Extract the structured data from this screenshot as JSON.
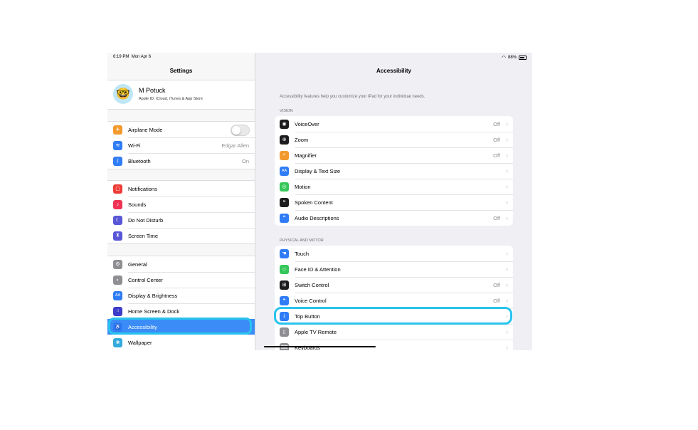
{
  "status_bar": {
    "time": "6:19 PM",
    "date": "Mon Apr 6",
    "battery": "88%"
  },
  "sidebar": {
    "title": "Settings",
    "profile": {
      "name": "M Potuck",
      "subtitle": "Apple ID, iCloud, iTunes & App Store"
    },
    "groups": [
      [
        {
          "label": "Airplane Mode",
          "icon": "airplane-icon",
          "color": "#f29a2e",
          "glyph": "✈",
          "toggle": false
        },
        {
          "label": "Wi-Fi",
          "icon": "wifi-icon",
          "color": "#2f7cf6",
          "glyph": "≋",
          "value": "Edgar Allen"
        },
        {
          "label": "Bluetooth",
          "icon": "bluetooth-icon",
          "color": "#2f7cf6",
          "glyph": "ᛒ",
          "value": "On"
        }
      ],
      [
        {
          "label": "Notifications",
          "icon": "notifications-icon",
          "color": "#ef3b36",
          "glyph": "▢"
        },
        {
          "label": "Sounds",
          "icon": "sounds-icon",
          "color": "#ef3355",
          "glyph": "♪"
        },
        {
          "label": "Do Not Disturb",
          "icon": "moon-icon",
          "color": "#5856d6",
          "glyph": "☾"
        },
        {
          "label": "Screen Time",
          "icon": "hourglass-icon",
          "color": "#5856d6",
          "glyph": "⧗"
        }
      ],
      [
        {
          "label": "General",
          "icon": "gear-icon",
          "color": "#8e8e93",
          "glyph": "⚙"
        },
        {
          "label": "Control Center",
          "icon": "toggles-icon",
          "color": "#8e8e93",
          "glyph": "◐"
        },
        {
          "label": "Display & Brightness",
          "icon": "display-icon",
          "color": "#2f7cf6",
          "glyph": "AA"
        },
        {
          "label": "Home Screen & Dock",
          "icon": "grid-icon",
          "color": "#3c3cc8",
          "glyph": "⁞⁞"
        },
        {
          "label": "Accessibility",
          "icon": "accessibility-icon",
          "color": "#2f7cf6",
          "glyph": "♿",
          "selected": true
        },
        {
          "label": "Wallpaper",
          "icon": "wallpaper-icon",
          "color": "#35aadc",
          "glyph": "❀"
        }
      ]
    ]
  },
  "detail": {
    "title": "Accessibility",
    "description": "Accessibility features help you customize your iPad for your individual needs.",
    "sections": [
      {
        "header": "VISION",
        "rows": [
          {
            "label": "VoiceOver",
            "icon": "voiceover-icon",
            "color": "#1c1c1e",
            "glyph": "◉",
            "value": "Off"
          },
          {
            "label": "Zoom",
            "icon": "zoom-icon",
            "color": "#1c1c1e",
            "glyph": "⊕",
            "value": "Off"
          },
          {
            "label": "Magnifier",
            "icon": "magnifier-icon",
            "color": "#f29a2e",
            "glyph": "⌕",
            "value": "Off"
          },
          {
            "label": "Display & Text Size",
            "icon": "text-size-icon",
            "color": "#2f7cf6",
            "glyph": "AA",
            "value": ""
          },
          {
            "label": "Motion",
            "icon": "motion-icon",
            "color": "#34c759",
            "glyph": "◎",
            "value": ""
          },
          {
            "label": "Spoken Content",
            "icon": "speech-bubble-icon",
            "color": "#1c1c1e",
            "glyph": "❝",
            "value": ""
          },
          {
            "label": "Audio Descriptions",
            "icon": "audio-description-icon",
            "color": "#2f7cf6",
            "glyph": "❞",
            "value": "Off"
          }
        ]
      },
      {
        "header": "PHYSICAL AND MOTOR",
        "rows": [
          {
            "label": "Touch",
            "icon": "touch-hand-icon",
            "color": "#2f7cf6",
            "glyph": "☚",
            "value": ""
          },
          {
            "label": "Face ID & Attention",
            "icon": "face-id-icon",
            "color": "#34c759",
            "glyph": "☺",
            "value": ""
          },
          {
            "label": "Switch Control",
            "icon": "switch-control-icon",
            "color": "#1c1c1e",
            "glyph": "⊞",
            "value": "Off"
          },
          {
            "label": "Voice Control",
            "icon": "voice-control-icon",
            "color": "#2f7cf6",
            "glyph": "❝",
            "value": "Off"
          },
          {
            "label": "Top Button",
            "icon": "top-button-icon",
            "color": "#2f7cf6",
            "glyph": "⤓",
            "value": ""
          },
          {
            "label": "Apple TV Remote",
            "icon": "remote-icon",
            "color": "#8e8e93",
            "glyph": "▯",
            "value": ""
          },
          {
            "label": "Keyboards",
            "icon": "keyboard-icon",
            "color": "#8e8e93",
            "glyph": "⌨",
            "value": ""
          }
        ]
      }
    ]
  },
  "highlight_color": "#28c3ee"
}
